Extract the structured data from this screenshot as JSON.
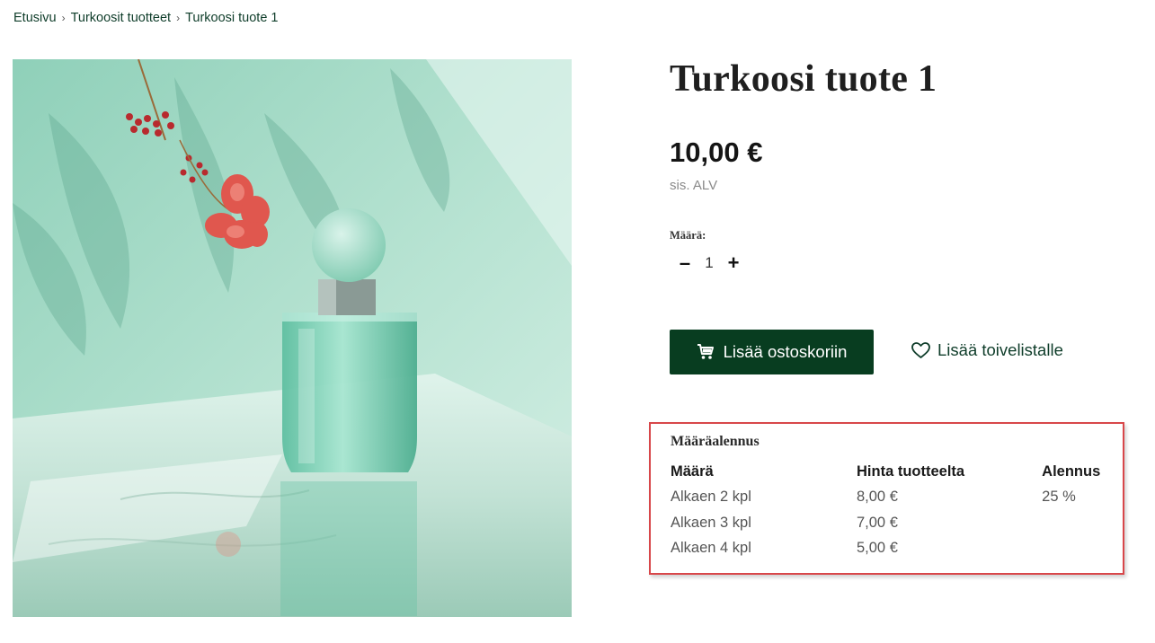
{
  "breadcrumb": [
    "Etusivu",
    "Turkoosit tuotteet",
    "Turkoosi tuote 1"
  ],
  "breadcrumb_separator": "›",
  "product": {
    "title": "Turkoosi tuote 1",
    "price": "10,00 €",
    "vat_note": "sis. ALV",
    "image_icon": "perfume-bottle-image"
  },
  "quantity": {
    "label": "Määrä:",
    "minus_label": "–",
    "value": "1",
    "plus_label": "+"
  },
  "actions": {
    "add_to_cart": "Lisää ostoskoriin",
    "add_to_cart_icon": "cart-icon",
    "add_to_wishlist": "Lisää toivelistalle",
    "add_to_wishlist_icon": "heart-icon"
  },
  "discount": {
    "title": "Määräalennus",
    "headers": [
      "Määrä",
      "Hinta tuotteelta",
      "Alennus"
    ],
    "rows": [
      [
        "Alkaen 2 kpl",
        "8,00 €",
        "25 %"
      ],
      [
        "Alkaen 3 kpl",
        "7,00 €",
        ""
      ],
      [
        "Alkaen 4 kpl",
        "5,00 €",
        ""
      ]
    ]
  },
  "colors": {
    "primary": "#083d20",
    "highlight_border": "#d8474a",
    "image_background": "#9fd6c3"
  }
}
